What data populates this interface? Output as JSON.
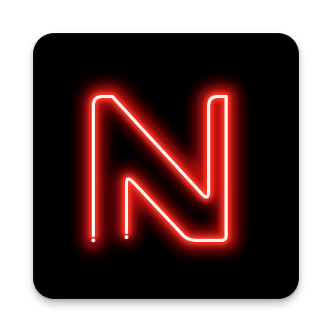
{
  "app_icon": {
    "name": "neon-n-logo-icon",
    "shape": "rounded-square",
    "colors": {
      "background": "#000000",
      "neon_core": "#fff3ec",
      "neon_inner": "#ff3a2a",
      "neon_glow": "#e01010"
    }
  }
}
